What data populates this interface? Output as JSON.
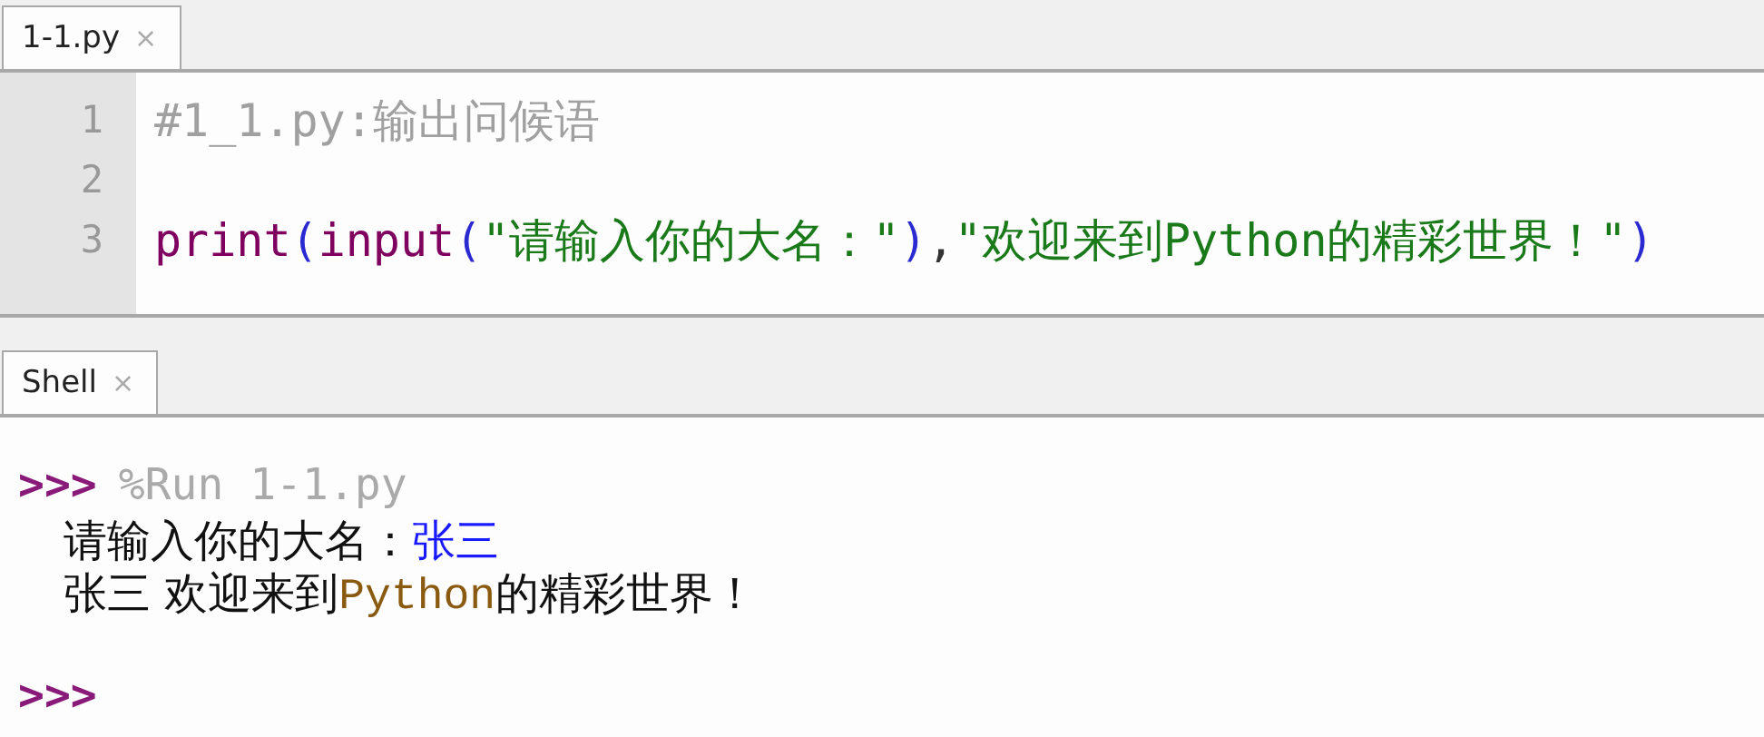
{
  "editor": {
    "tabs": [
      {
        "label": "1-1.py",
        "close": "×",
        "selected": true
      }
    ],
    "lines": [
      {
        "number": "1",
        "tokens": [
          {
            "kind": "comment",
            "text": "#1_1.py:输出问候语"
          }
        ]
      },
      {
        "number": "2"
      },
      {
        "number": "3",
        "tokens": [
          {
            "kind": "builtin",
            "text": "print"
          },
          {
            "kind": "paren",
            "text": "("
          },
          {
            "kind": "builtin",
            "text": "input"
          },
          {
            "kind": "paren",
            "text": "("
          },
          {
            "kind": "string",
            "text": "\"请输入你的大名：\""
          },
          {
            "kind": "paren",
            "text": ")"
          },
          {
            "kind": "plain",
            "text": ","
          },
          {
            "kind": "string",
            "text": "\"欢迎来到Python的精彩世界！\""
          },
          {
            "kind": "paren",
            "text": ")"
          }
        ]
      }
    ]
  },
  "shell": {
    "tabs": [
      {
        "label": "Shell",
        "close": "×",
        "selected": true
      }
    ],
    "lines": [
      {
        "kind": "command",
        "prompt": ">>>",
        "text": "%Run 1-1.py"
      },
      {
        "kind": "output",
        "segments": [
          {
            "kind": "text",
            "text": "请输入你的大名："
          },
          {
            "kind": "input",
            "text": "张三"
          }
        ]
      },
      {
        "kind": "output",
        "segments": [
          {
            "kind": "text",
            "text": "张三 欢迎来到"
          },
          {
            "kind": "mono",
            "text": "Python"
          },
          {
            "kind": "text",
            "text": "的精彩世界！"
          }
        ]
      },
      {
        "kind": "blank"
      },
      {
        "kind": "command",
        "prompt": ">>>"
      }
    ]
  }
}
